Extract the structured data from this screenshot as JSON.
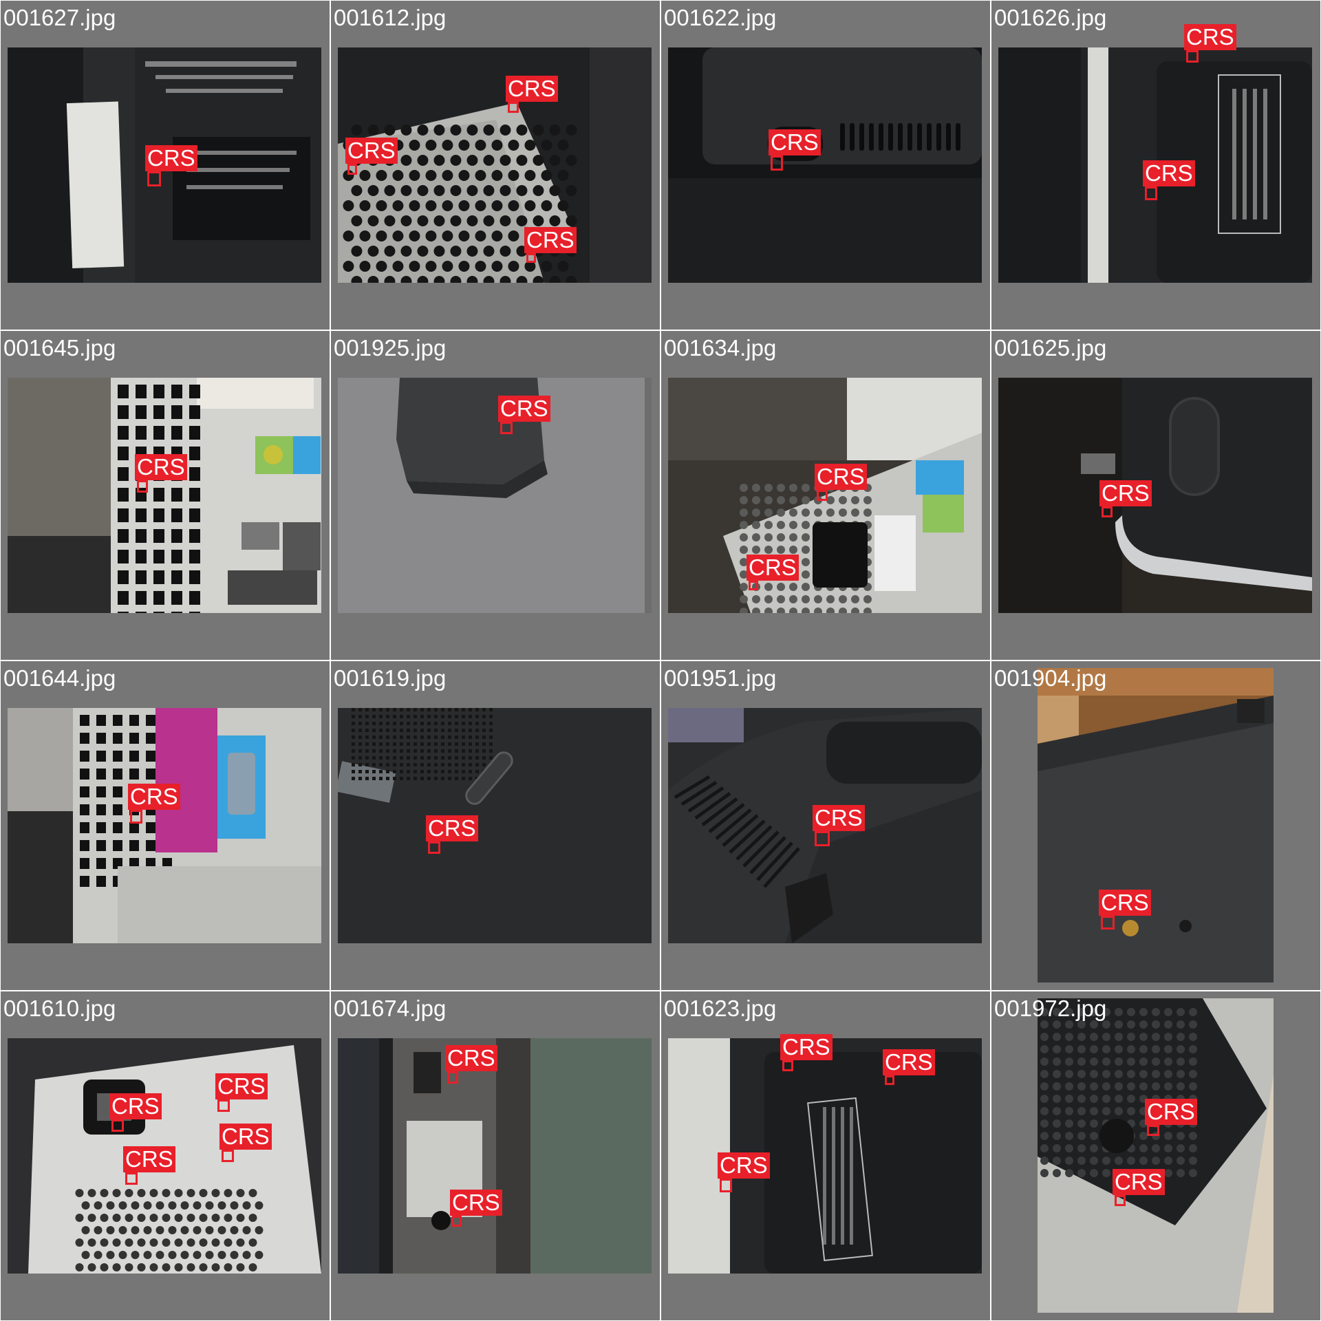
{
  "grid": {
    "tiles": [
      {
        "filename": "001627.jpg",
        "scene": "psu-label-tower",
        "dets": [
          {
            "label": "CRS"
          }
        ]
      },
      {
        "filename": "001612.jpg",
        "scene": "psu-mesh-grill",
        "dets": [
          {
            "label": "CRS"
          },
          {
            "label": "CRS"
          },
          {
            "label": "CRS"
          }
        ]
      },
      {
        "filename": "001622.jpg",
        "scene": "monitor-back-vents",
        "dets": [
          {
            "label": "CRS"
          }
        ]
      },
      {
        "filename": "001626.jpg",
        "scene": "monitor-back-label",
        "dets": [
          {
            "label": "CRS"
          },
          {
            "label": "CRS"
          }
        ]
      },
      {
        "filename": "001645.jpg",
        "scene": "tower-rear-io",
        "dets": [
          {
            "label": "CRS"
          }
        ]
      },
      {
        "filename": "001925.jpg",
        "scene": "stand-on-grey-table",
        "dets": [
          {
            "label": "CRS"
          }
        ]
      },
      {
        "filename": "001634.jpg",
        "scene": "tower-psu-socket",
        "dets": [
          {
            "label": "CRS"
          },
          {
            "label": "CRS"
          }
        ]
      },
      {
        "filename": "001625.jpg",
        "scene": "monitor-back-oval",
        "dets": [
          {
            "label": "CRS"
          }
        ]
      },
      {
        "filename": "001644.jpg",
        "scene": "tower-parallel-serial",
        "dets": [
          {
            "label": "CRS"
          }
        ]
      },
      {
        "filename": "001619.jpg",
        "scene": "laptop-bottom",
        "dets": [
          {
            "label": "CRS"
          }
        ]
      },
      {
        "filename": "001951.jpg",
        "scene": "monitor-back-stand",
        "dets": [
          {
            "label": "CRS"
          }
        ]
      },
      {
        "filename": "001904.jpg",
        "scene": "keyboard-underside",
        "dets": [
          {
            "label": "CRS"
          }
        ]
      },
      {
        "filename": "001610.jpg",
        "scene": "psu-silver-socket",
        "dets": [
          {
            "label": "CRS"
          },
          {
            "label": "CRS"
          },
          {
            "label": "CRS"
          },
          {
            "label": "CRS"
          }
        ]
      },
      {
        "filename": "001674.jpg",
        "scene": "counter-device-plate",
        "dets": [
          {
            "label": "CRS"
          },
          {
            "label": "CRS"
          }
        ]
      },
      {
        "filename": "001623.jpg",
        "scene": "monitor-back-label-2",
        "dets": [
          {
            "label": "CRS"
          },
          {
            "label": "CRS"
          },
          {
            "label": "CRS"
          }
        ]
      },
      {
        "filename": "001972.jpg",
        "scene": "mini-pc-underside",
        "dets": [
          {
            "label": "CRS"
          },
          {
            "label": "CRS"
          }
        ]
      }
    ]
  }
}
